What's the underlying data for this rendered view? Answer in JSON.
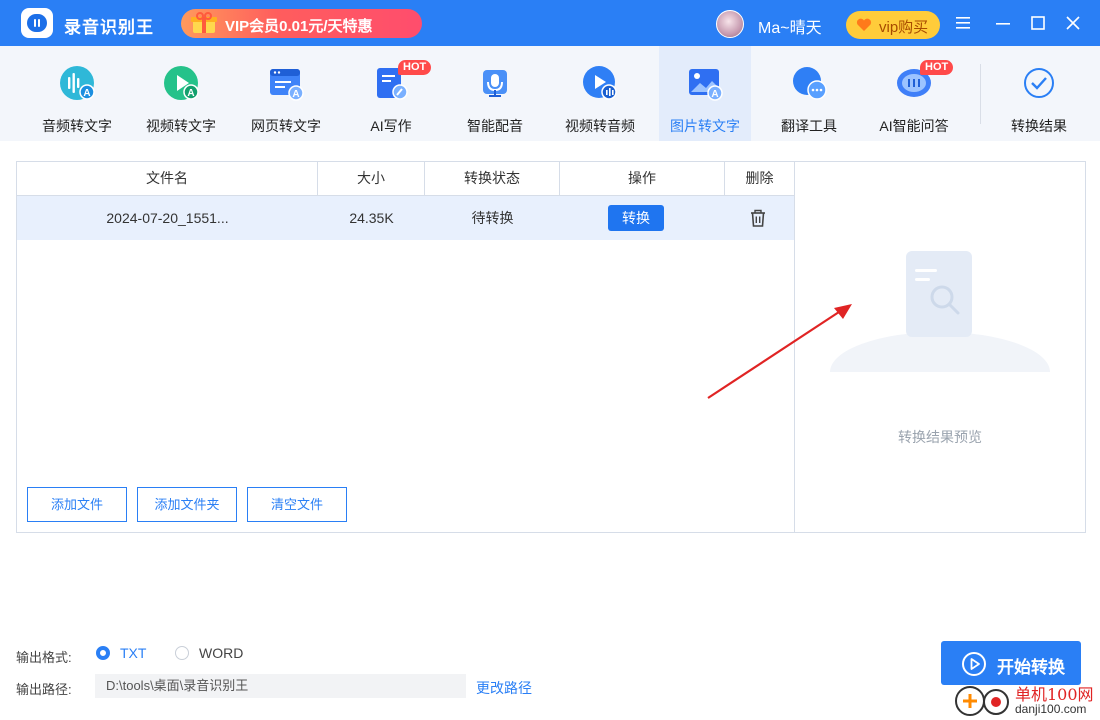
{
  "app": {
    "title": "录音识别王"
  },
  "header": {
    "vip_banner": "VIP会员0.01元/天特惠",
    "username": "Ma~晴天",
    "vip_buy": "vip购买"
  },
  "toolbar": {
    "items": [
      {
        "label": "音频转文字",
        "icon": "audio-to-text-icon"
      },
      {
        "label": "视频转文字",
        "icon": "video-to-text-icon"
      },
      {
        "label": "网页转文字",
        "icon": "webpage-to-text-icon"
      },
      {
        "label": "AI写作",
        "icon": "ai-writing-icon",
        "badge": "HOT"
      },
      {
        "label": "智能配音",
        "icon": "microphone-icon"
      },
      {
        "label": "视频转音频",
        "icon": "video-to-audio-icon"
      },
      {
        "label": "图片转文字",
        "icon": "image-to-text-icon",
        "active": true
      },
      {
        "label": "翻译工具",
        "icon": "translate-icon"
      },
      {
        "label": "AI智能问答",
        "icon": "ai-chat-icon",
        "badge": "HOT"
      },
      {
        "label": "转换结果",
        "icon": "check-circle-icon"
      }
    ]
  },
  "file_table": {
    "columns": [
      "文件名",
      "大小",
      "转换状态",
      "操作",
      "删除"
    ],
    "rows": [
      {
        "name": "2024-07-20_1551...",
        "size": "24.35K",
        "status": "待转换",
        "action": "转换"
      }
    ]
  },
  "file_buttons": {
    "add_file": "添加文件",
    "add_folder": "添加文件夹",
    "clear": "清空文件"
  },
  "preview": {
    "placeholder": "转换结果预览"
  },
  "output": {
    "format_label": "输出格式:",
    "formats": [
      "TXT",
      "WORD"
    ],
    "selected_format": "TXT",
    "path_label": "输出路径:",
    "path_value": "D:\\tools\\桌面\\录音识别王",
    "change_path": "更改路径"
  },
  "start_button": "开始转换",
  "watermark": {
    "brand": "单机100网",
    "site": "danji100.com"
  },
  "colors": {
    "primary": "#2a7ff5",
    "hot": "#ff4a4a",
    "vip": "#ffcc3a"
  }
}
